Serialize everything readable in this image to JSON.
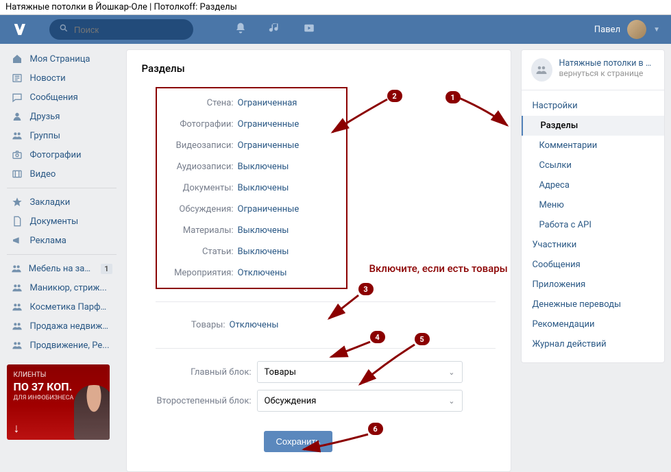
{
  "browser_title": "Натяжные потолки в Йошкар-Оле | Потолкоff: Разделы",
  "header": {
    "search_placeholder": "Поиск",
    "user_name": "Павел"
  },
  "leftnav": {
    "my_page": "Моя Страница",
    "news": "Новости",
    "messages": "Сообщения",
    "friends": "Друзья",
    "groups": "Группы",
    "photos": "Фотографии",
    "videos": "Видео",
    "bookmarks": "Закладки",
    "documents": "Документы",
    "ads": "Реклама",
    "g1": "Мебель на зака...",
    "g1_badge": "1",
    "g2": "Маникюр, стриж...",
    "g3": "Косметика Парфю...",
    "g4": "Продажа недвижи...",
    "g5": "Продвижение, Ре..."
  },
  "ad": {
    "line1": "КЛИЕНТЫ",
    "line2": "ПО 37 КОП.",
    "line3": "ДЛЯ ИНФОБИЗНЕСА"
  },
  "main": {
    "title": "Разделы",
    "rows": [
      {
        "label": "Стена:",
        "value": "Ограниченная"
      },
      {
        "label": "Фотографии:",
        "value": "Ограниченные"
      },
      {
        "label": "Видеозаписи:",
        "value": "Ограниченные"
      },
      {
        "label": "Аудиозаписи:",
        "value": "Выключены"
      },
      {
        "label": "Документы:",
        "value": "Выключены"
      },
      {
        "label": "Обсуждения:",
        "value": "Ограниченные"
      },
      {
        "label": "Материалы:",
        "value": "Выключены"
      },
      {
        "label": "Статьи:",
        "value": "Выключены"
      },
      {
        "label": "Мероприятия:",
        "value": "Отключены"
      }
    ],
    "products_label": "Товары:",
    "products_value": "Отключены",
    "main_block_label": "Главный блок:",
    "main_block_value": "Товары",
    "secondary_block_label": "Второстепенный блок:",
    "secondary_block_value": "Обсуждения",
    "save": "Сохранить"
  },
  "right": {
    "group_title": "Натяжные потолки в Йо...",
    "group_sub": "вернуться к странице",
    "settings": "Настройки",
    "sections": "Разделы",
    "comments": "Комментарии",
    "links": "Ссылки",
    "addresses": "Адреса",
    "menu": "Меню",
    "api": "Работа с API",
    "members": "Участники",
    "msgs": "Сообщения",
    "apps": "Приложения",
    "money": "Денежные переводы",
    "recs": "Рекомендации",
    "log": "Журнал действий"
  },
  "annotations": {
    "n1": "1",
    "n2": "2",
    "n3": "3",
    "n4": "4",
    "n5": "5",
    "n6": "6",
    "hint": "Включите, если есть товары"
  }
}
